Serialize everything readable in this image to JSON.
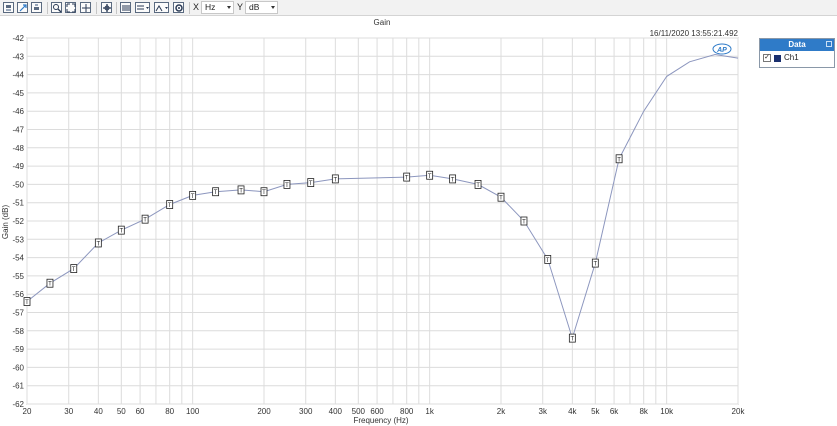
{
  "toolbar": {
    "x_axis_label": "X",
    "x_unit": "Hz",
    "y_axis_label": "Y",
    "y_unit": "dB",
    "tools": [
      "save-icon",
      "export-icon",
      "print-icon",
      "zoom-icon",
      "fit-all-icon",
      "fit-icon",
      "crosshair-icon",
      "table-icon",
      "axis-menu-icon",
      "style-menu-icon",
      "settings-icon"
    ]
  },
  "chart": {
    "title": "Gain",
    "timestamp": "16/11/2020 13:55:21.492",
    "watermark": "AP",
    "line_color": "#8c96be"
  },
  "legend": {
    "header": "Data",
    "items": [
      {
        "name": "Ch1",
        "color": "#1a2f6e",
        "checked": true
      }
    ]
  },
  "chart_data": {
    "type": "line",
    "title": "Gain",
    "xlabel": "Frequency (Hz)",
    "ylabel": "Gain (dB)",
    "x_scale": "log",
    "xlim": [
      20,
      20000
    ],
    "ylim": [
      -62,
      -42
    ],
    "grid": true,
    "legend_position": "top-right",
    "x_ticks": [
      20,
      30,
      40,
      50,
      60,
      80,
      100,
      200,
      300,
      400,
      500,
      600,
      800,
      1000,
      2000,
      3000,
      4000,
      5000,
      6000,
      8000,
      10000,
      20000
    ],
    "x_tick_labels": [
      "20",
      "30",
      "40",
      "50",
      "60",
      "80",
      "100",
      "200",
      "300",
      "400",
      "500",
      "600",
      "800",
      "1k",
      "2k",
      "3k",
      "4k",
      "5k",
      "6k",
      "8k",
      "10k",
      "20k"
    ],
    "y_ticks": [
      -42,
      -43,
      -44,
      -45,
      -46,
      -47,
      -48,
      -49,
      -50,
      -51,
      -52,
      -53,
      -54,
      -55,
      -56,
      -57,
      -58,
      -59,
      -60,
      -61,
      -62
    ],
    "y_tick_labels": [
      "-42",
      "-43",
      "-44",
      "-45",
      "-46",
      "-47",
      "-48",
      "-49",
      "-50",
      "-51",
      "-52",
      "-53",
      "-54",
      "-55",
      "-56",
      "-57",
      "-58",
      "-59",
      "-60",
      "-61",
      "-62"
    ],
    "series": [
      {
        "name": "Ch1",
        "x": [
          20,
          25,
          31.5,
          40,
          50,
          63,
          80,
          100,
          125,
          160,
          200,
          250,
          315,
          400,
          800,
          1000,
          1250,
          1600,
          2000,
          2500,
          3150,
          4000,
          5000,
          6300,
          8000,
          10000,
          12500,
          16000,
          20000
        ],
        "y": [
          -56.4,
          -55.4,
          -54.6,
          -53.2,
          -52.5,
          -51.9,
          -51.1,
          -50.6,
          -50.4,
          -50.3,
          -50.4,
          -50.0,
          -49.9,
          -49.7,
          -49.6,
          -49.5,
          -49.7,
          -50.0,
          -50.7,
          -52.0,
          -54.1,
          -58.4,
          -54.3,
          -48.6,
          -46.0,
          -44.1,
          -43.3,
          -42.9,
          -43.1
        ],
        "markers": [
          true,
          true,
          true,
          true,
          true,
          true,
          true,
          true,
          true,
          true,
          true,
          true,
          true,
          true,
          true,
          true,
          true,
          true,
          true,
          true,
          true,
          true,
          true,
          true,
          false,
          false,
          false,
          false,
          false
        ],
        "marker_label": "T"
      }
    ]
  }
}
